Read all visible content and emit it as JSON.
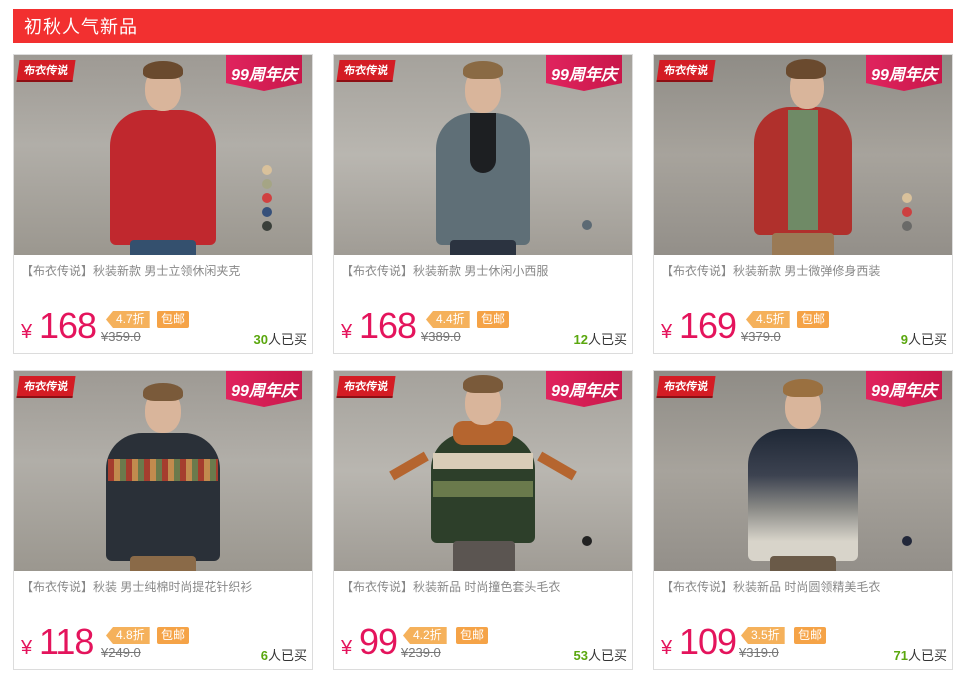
{
  "section": {
    "title": "初秋人气新品"
  },
  "badges": {
    "brand": "布衣传说",
    "anniversary": "99周年庆"
  },
  "currency": "¥",
  "sold_suffix": "人已买",
  "products": [
    {
      "title": "【布衣传说】秋装新款 男士立领休闲夹克",
      "price": "168",
      "discount": "4.7折",
      "shipping": "包邮",
      "original_price": "359.0",
      "sold": "30",
      "garment_color": "#c0282e",
      "swatches": [
        "#d9c19b",
        "#a5a585",
        "#d04040",
        "#36507a",
        "#3a3f3a"
      ]
    },
    {
      "title": "【布衣传说】秋装新款 男士休闲小西服",
      "price": "168",
      "discount": "4.4折",
      "shipping": "包邮",
      "original_price": "389.0",
      "sold": "12",
      "garment_color": "#5f6f77",
      "swatches": [
        "#5c6a74"
      ]
    },
    {
      "title": "【布衣传说】秋装新款 男士微弹修身西装",
      "price": "169",
      "discount": "4.5折",
      "shipping": "包邮",
      "original_price": "379.0",
      "sold": "9",
      "garment_color": "#b0302c",
      "swatches": [
        "#d9c19b",
        "#cc4040",
        "#6a6a68"
      ]
    },
    {
      "title": "【布衣传说】秋装 男士纯棉时尚提花针织衫",
      "price": "118",
      "discount": "4.8折",
      "shipping": "包邮",
      "original_price": "249.0",
      "sold": "6",
      "garment_color": "#2a3038",
      "swatches": []
    },
    {
      "title": "【布衣传说】秋装新品 时尚撞色套头毛衣",
      "price": "99",
      "discount": "4.2折",
      "shipping": "包邮",
      "original_price": "239.0",
      "sold": "53",
      "garment_color": "#2d3f2a",
      "swatches": [
        "#222222"
      ]
    },
    {
      "title": "【布衣传说】秋装新品 时尚圆领精美毛衣",
      "price": "109",
      "discount": "3.5折",
      "shipping": "包邮",
      "original_price": "319.0",
      "sold": "71",
      "garment_color": "#3b4048",
      "swatches": [
        "#22283a"
      ]
    }
  ]
}
